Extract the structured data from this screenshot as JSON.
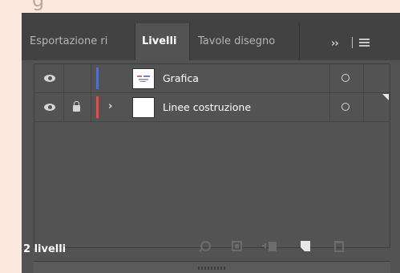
{
  "tabs": [
    {
      "label": "Esportazione ri",
      "active": false
    },
    {
      "label": "Livelli",
      "active": true
    },
    {
      "label": "Tavole disegno",
      "active": false
    }
  ],
  "tab_overflow_label": "››",
  "layers": [
    {
      "name": "Grafica",
      "visible": true,
      "locked": false,
      "color": "#4f6fd8",
      "expandable": false,
      "thumbnail": "artwork"
    },
    {
      "name": "Linee costruzione",
      "visible": true,
      "locked": true,
      "color": "#e84b4b",
      "expandable": true,
      "thumbnail": "blank"
    }
  ],
  "footer": {
    "count_label": "2 livelli"
  },
  "icons": {
    "visibility": "eye-icon",
    "lock": "lock-icon",
    "expand": "chevron-right-icon",
    "target": "target-circle-icon",
    "panel_menu": "hamburger-menu-icon",
    "locate": "search-icon",
    "clip": "clipping-mask-icon",
    "sublayer": "new-sublayer-icon",
    "new_layer": "new-layer-icon",
    "delete": "trash-icon"
  }
}
